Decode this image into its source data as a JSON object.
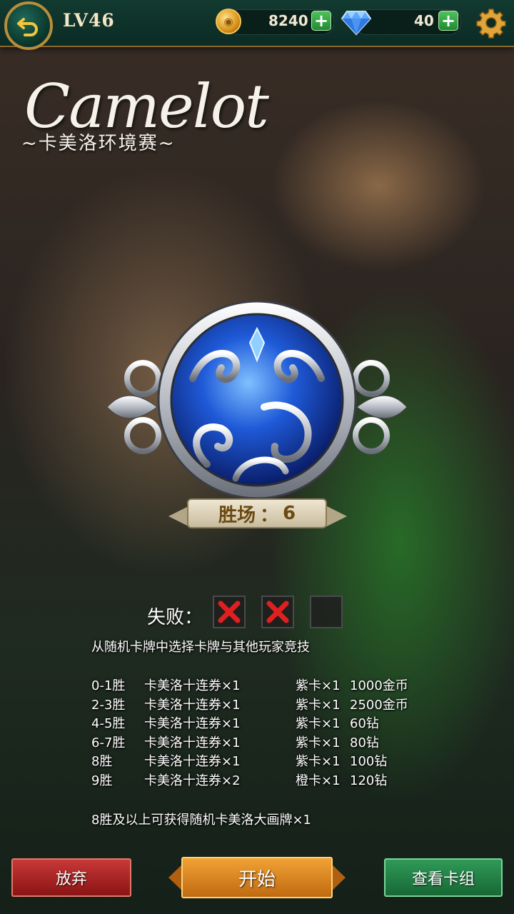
{
  "header": {
    "level": "LV46",
    "coins": "8240",
    "gems": "40",
    "plus_symbol": "+",
    "icons": [
      "back-arrow-icon",
      "coin-icon",
      "diamond-icon",
      "gear-icon"
    ]
  },
  "event": {
    "title": "Camelot",
    "subtitle": "~卡美洛环境赛~"
  },
  "progress": {
    "wins_label": "胜场",
    "wins_separator": "：",
    "wins_value": "6",
    "losses_label": "失败：",
    "losses_max": 3,
    "losses_count": 2
  },
  "description": "从随机卡牌中选择卡牌与其他玩家竞技",
  "rewards": [
    {
      "wins": "0-1胜",
      "tickets": "卡美洛十连券×1",
      "card": "紫卡×1",
      "extra": "1000金币"
    },
    {
      "wins": "2-3胜",
      "tickets": "卡美洛十连券×1",
      "card": "紫卡×1",
      "extra": "2500金币"
    },
    {
      "wins": "4-5胜",
      "tickets": "卡美洛十连券×1",
      "card": "紫卡×1",
      "extra": "60钻"
    },
    {
      "wins": "6-7胜",
      "tickets": "卡美洛十连券×1",
      "card": "紫卡×1",
      "extra": "80钻"
    },
    {
      "wins": "8胜",
      "tickets": "卡美洛十连券×1",
      "card": "紫卡×1",
      "extra": "100钻"
    },
    {
      "wins": "9胜",
      "tickets": "卡美洛十连券×2",
      "card": "橙卡×1",
      "extra": "120钻"
    }
  ],
  "bonus_note": "8胜及以上可获得随机卡美洛大画牌×1",
  "buttons": {
    "give_up": "放弃",
    "start": "开始",
    "view_deck": "查看卡组"
  },
  "colors": {
    "header_bg": "#0b2b24",
    "gold_trim": "#b88d3c",
    "give_up": "#b02020",
    "start": "#e08a20",
    "view_deck": "#238043",
    "loss_mark": "#e02020"
  }
}
